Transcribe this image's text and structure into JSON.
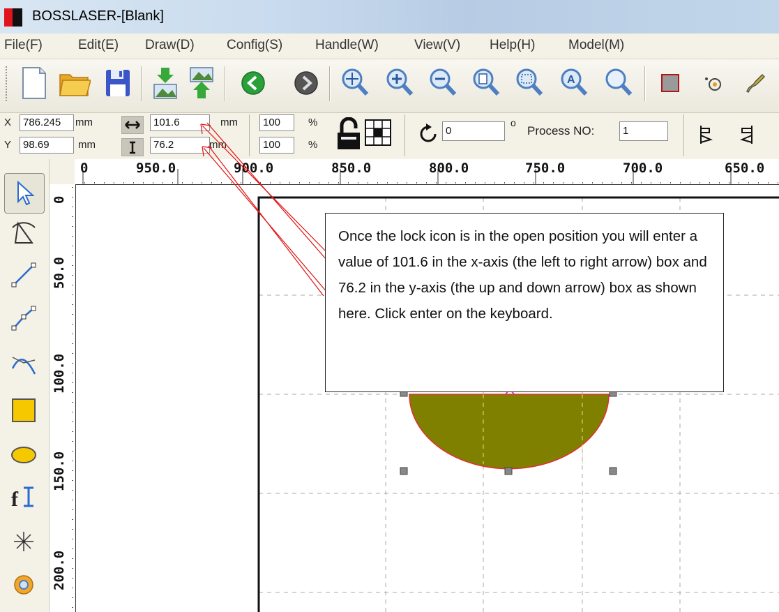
{
  "window": {
    "title": "BOSSLASER-[Blank]"
  },
  "menu": [
    "File(F)",
    "Edit(E)",
    "Draw(D)",
    "Config(S)",
    "Handle(W)",
    "View(V)",
    "Help(H)",
    "Model(M)"
  ],
  "toolbar": {
    "buttons": [
      "new-file",
      "open-folder",
      "save",
      "import",
      "export",
      "back",
      "forward",
      "zoom-pan",
      "zoom-in",
      "zoom-out",
      "zoom-page",
      "zoom-select",
      "zoom-all",
      "zoom-window",
      "frame",
      "path-node",
      "pen"
    ]
  },
  "properties": {
    "x_label": "X",
    "x_value": "786.245",
    "x_unit": "mm",
    "y_label": "Y",
    "y_value": "98.69",
    "y_unit": "mm",
    "width_value": "101.6",
    "width_unit": "mm",
    "height_value": "76.2",
    "height_unit": "mm",
    "scale_x": "100",
    "scale_x_unit": "%",
    "scale_y": "100",
    "scale_y_unit": "%",
    "rotate_value": "0",
    "rotate_unit": "o",
    "process_label": "Process NO:",
    "process_value": "1"
  },
  "rulers": {
    "horizontal": [
      "0",
      "950.0",
      "900.0",
      "850.0",
      "800.0",
      "750.0",
      "700.0",
      "650.0"
    ],
    "vertical": [
      "0",
      "50.0",
      "100.0",
      "150.0",
      "200.0"
    ]
  },
  "tools": [
    "select",
    "node-edit",
    "line",
    "polyline",
    "curve",
    "rectangle",
    "ellipse",
    "text",
    "dot",
    "webcam"
  ],
  "callout": {
    "text": "Once the lock icon is in the open position you will enter a value of 101.6 in the x-axis (the left to right arrow) box and 76.2 in the y-axis (the up and down arrow) box as shown here. Click enter on the keyboard."
  },
  "colors": {
    "shape_fill": "#808000",
    "shape_outline": "#e03030",
    "arrow": "#e01010"
  }
}
